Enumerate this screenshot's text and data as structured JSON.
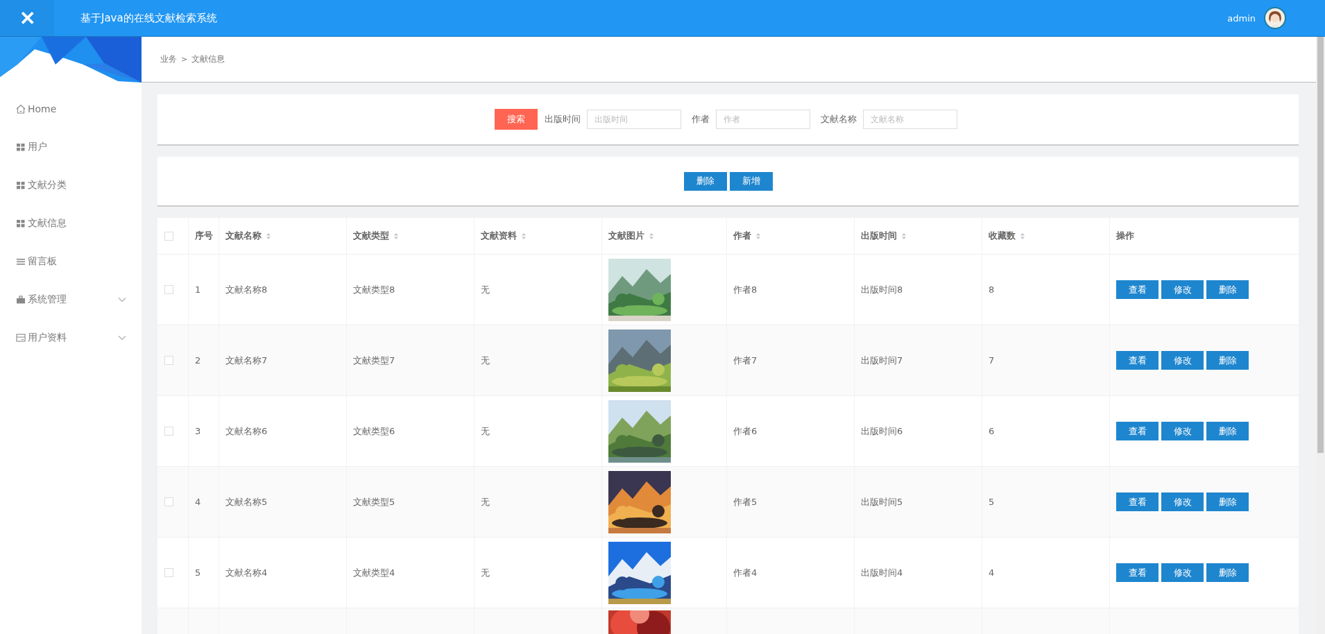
{
  "header": {
    "close_glyph": "✕",
    "title": "基于Java的在线文献检索系统",
    "user": "admin"
  },
  "sidebar": {
    "items": [
      {
        "label": "Home",
        "kind": "link",
        "selected": false
      },
      {
        "label": "用户",
        "kind": "link",
        "selected": false
      },
      {
        "label": "文献分类",
        "kind": "link",
        "selected": false
      },
      {
        "label": "文献信息",
        "kind": "link",
        "selected": false
      },
      {
        "label": "留言板",
        "kind": "link",
        "selected": false
      },
      {
        "label": "系统管理",
        "kind": "submenu",
        "selected": false,
        "expanded": false
      },
      {
        "label": "用户资料",
        "kind": "submenu",
        "selected": false,
        "expanded": false
      }
    ]
  },
  "breadcrumb": {
    "items": [
      "业务",
      "文献信息"
    ],
    "separator": ">"
  },
  "search": {
    "button": "搜索",
    "fields": [
      {
        "label": "出版时间",
        "placeholder": "出版时间"
      },
      {
        "label": "作者",
        "placeholder": "作者"
      },
      {
        "label": "文献名称",
        "placeholder": "文献名称"
      }
    ]
  },
  "toolbar": {
    "buttons": [
      {
        "label": "删除",
        "kind": "primary"
      },
      {
        "label": "新增",
        "kind": "primary"
      }
    ]
  },
  "table": {
    "select_all": {
      "checked": false
    },
    "columns": [
      {
        "label": "序号",
        "sortable": false
      },
      {
        "label": "文献名称",
        "sortable": true
      },
      {
        "label": "文献类型",
        "sortable": true
      },
      {
        "label": "文献资料",
        "sortable": true
      },
      {
        "label": "文献图片",
        "sortable": true
      },
      {
        "label": "作者",
        "sortable": true
      },
      {
        "label": "出版时间",
        "sortable": true
      },
      {
        "label": "收藏数",
        "sortable": true
      },
      {
        "label": "操作",
        "sortable": false
      }
    ],
    "rows": [
      {
        "checked": false,
        "index": "1",
        "name": "文献名称8",
        "type": "文献类型8",
        "material": "无",
        "author": "作者8",
        "date": "出版时间8",
        "favorites": "8",
        "actions": [
          "查看",
          "修改",
          "删除"
        ]
      },
      {
        "checked": false,
        "index": "2",
        "name": "文献名称7",
        "type": "文献类型7",
        "material": "无",
        "author": "作者7",
        "date": "出版时间7",
        "favorites": "7",
        "actions": [
          "查看",
          "修改",
          "删除"
        ]
      },
      {
        "checked": false,
        "index": "3",
        "name": "文献名称6",
        "type": "文献类型6",
        "material": "无",
        "author": "作者6",
        "date": "出版时间6",
        "favorites": "6",
        "actions": [
          "查看",
          "修改",
          "删除"
        ]
      },
      {
        "checked": false,
        "index": "4",
        "name": "文献名称5",
        "type": "文献类型5",
        "material": "无",
        "author": "作者5",
        "date": "出版时间5",
        "favorites": "5",
        "actions": [
          "查看",
          "修改",
          "删除"
        ]
      },
      {
        "checked": false,
        "index": "5",
        "name": "文献名称4",
        "type": "文献类型4",
        "material": "无",
        "author": "作者4",
        "date": "出版时间4",
        "favorites": "4",
        "actions": [
          "查看",
          "修改",
          "删除"
        ]
      }
    ]
  }
}
